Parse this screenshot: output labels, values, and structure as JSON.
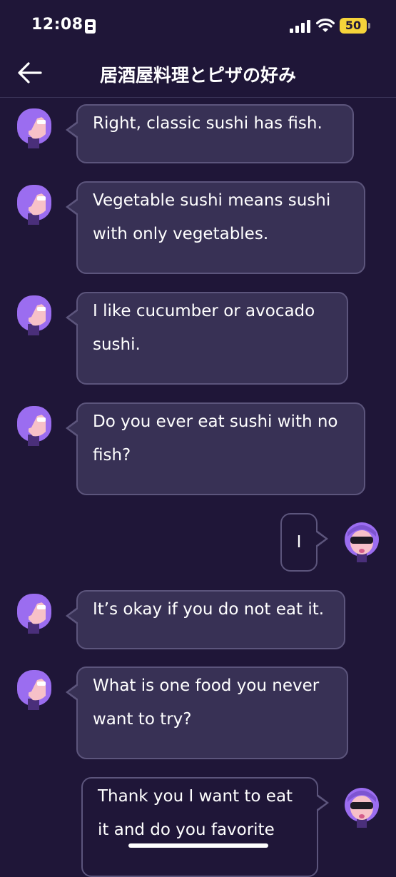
{
  "status_bar": {
    "time": "12:08",
    "battery": "50"
  },
  "header": {
    "title": "居酒屋料理とピザの好み"
  },
  "messages": [
    {
      "sender": "bot",
      "text": "Right, classic sushi has fish."
    },
    {
      "sender": "bot",
      "text": "Vegetable sushi means sushi with only vegetables."
    },
    {
      "sender": "bot",
      "text": "I like cucumber or avocado sushi."
    },
    {
      "sender": "bot",
      "text": "Do you ever eat sushi with no fish?"
    },
    {
      "sender": "user",
      "text": "I"
    },
    {
      "sender": "bot",
      "text": "It’s okay if you do not eat it."
    },
    {
      "sender": "bot",
      "text": "What is one food you never want to try?"
    },
    {
      "sender": "user",
      "text": "Thank you I want to eat it and do you favorite"
    }
  ],
  "icons": {
    "back": "arrow-left-icon",
    "signal": "cellular-signal-icon",
    "wifi": "wifi-icon",
    "sim": "sim-card-icon",
    "battery": "battery-icon"
  },
  "colors": {
    "background": "#1f1638",
    "bubble": "#383155",
    "bubble_border": "#5c557c",
    "bot_avatar_hair": "#9b6df0",
    "user_avatar_hood": "#9b6df0",
    "battery": "#f5d33a"
  }
}
